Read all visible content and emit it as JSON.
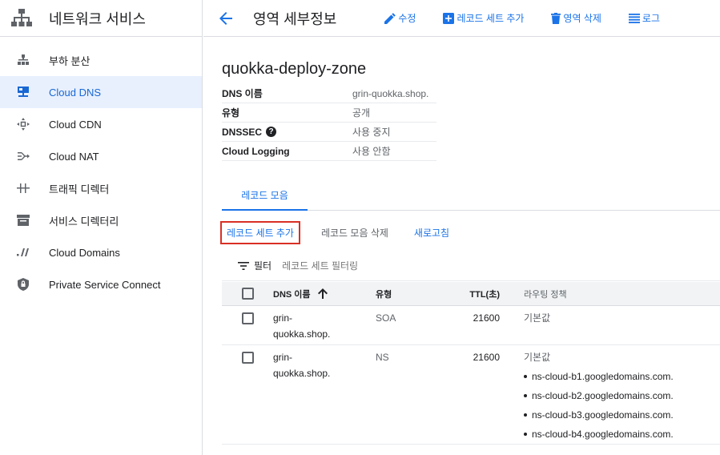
{
  "sidebar": {
    "title": "네트워크 서비스",
    "items": [
      {
        "label": "부하 분산",
        "icon": "load-balancer-icon"
      },
      {
        "label": "Cloud DNS",
        "icon": "dns-icon"
      },
      {
        "label": "Cloud CDN",
        "icon": "cdn-icon"
      },
      {
        "label": "Cloud NAT",
        "icon": "nat-icon"
      },
      {
        "label": "트래픽 디렉터",
        "icon": "traffic-director-icon"
      },
      {
        "label": "서비스 디렉터리",
        "icon": "service-directory-icon"
      },
      {
        "label": "Cloud Domains",
        "icon": "domains-icon"
      },
      {
        "label": "Private Service Connect",
        "icon": "private-connect-icon"
      }
    ],
    "active_index": 1
  },
  "header": {
    "title": "영역 세부정보",
    "edit": "수정",
    "add_record_set": "레코드 세트 추가",
    "delete_zone": "영역 삭제",
    "logs": "로그"
  },
  "zone": {
    "name": "quokka-deploy-zone",
    "details": [
      {
        "key": "DNS 이름",
        "value": "grin-quokka.shop."
      },
      {
        "key": "유형",
        "value": "공개"
      },
      {
        "key": "DNSSEC",
        "value": "사용 중지"
      },
      {
        "key": "Cloud Logging",
        "value": "사용 안함"
      }
    ]
  },
  "tabs": {
    "record_sets": "레코드 모음"
  },
  "actions": {
    "add_record_set": "레코드 세트 추가",
    "delete_record_sets": "레코드 모음 삭제",
    "refresh": "새로고침"
  },
  "filter": {
    "label": "필터",
    "placeholder": "레코드 세트 필터링"
  },
  "table": {
    "columns": {
      "name": "DNS 이름",
      "type": "유형",
      "ttl": "TTL(초)",
      "routing": "라우팅 정책"
    },
    "rows": [
      {
        "name_line1": "grin-",
        "name_line2": "quokka.shop.",
        "type": "SOA",
        "ttl": "21600",
        "routing": "기본값",
        "data": []
      },
      {
        "name_line1": "grin-",
        "name_line2": "quokka.shop.",
        "type": "NS",
        "ttl": "21600",
        "routing": "기본값",
        "data": [
          "ns-cloud-b1.googledomains.com.",
          "ns-cloud-b2.googledomains.com.",
          "ns-cloud-b3.googledomains.com.",
          "ns-cloud-b4.googledomains.com."
        ]
      }
    ]
  },
  "colors": {
    "accent": "#1a73e8",
    "active_bg": "#e8f0fe",
    "highlight": "#d93025"
  }
}
